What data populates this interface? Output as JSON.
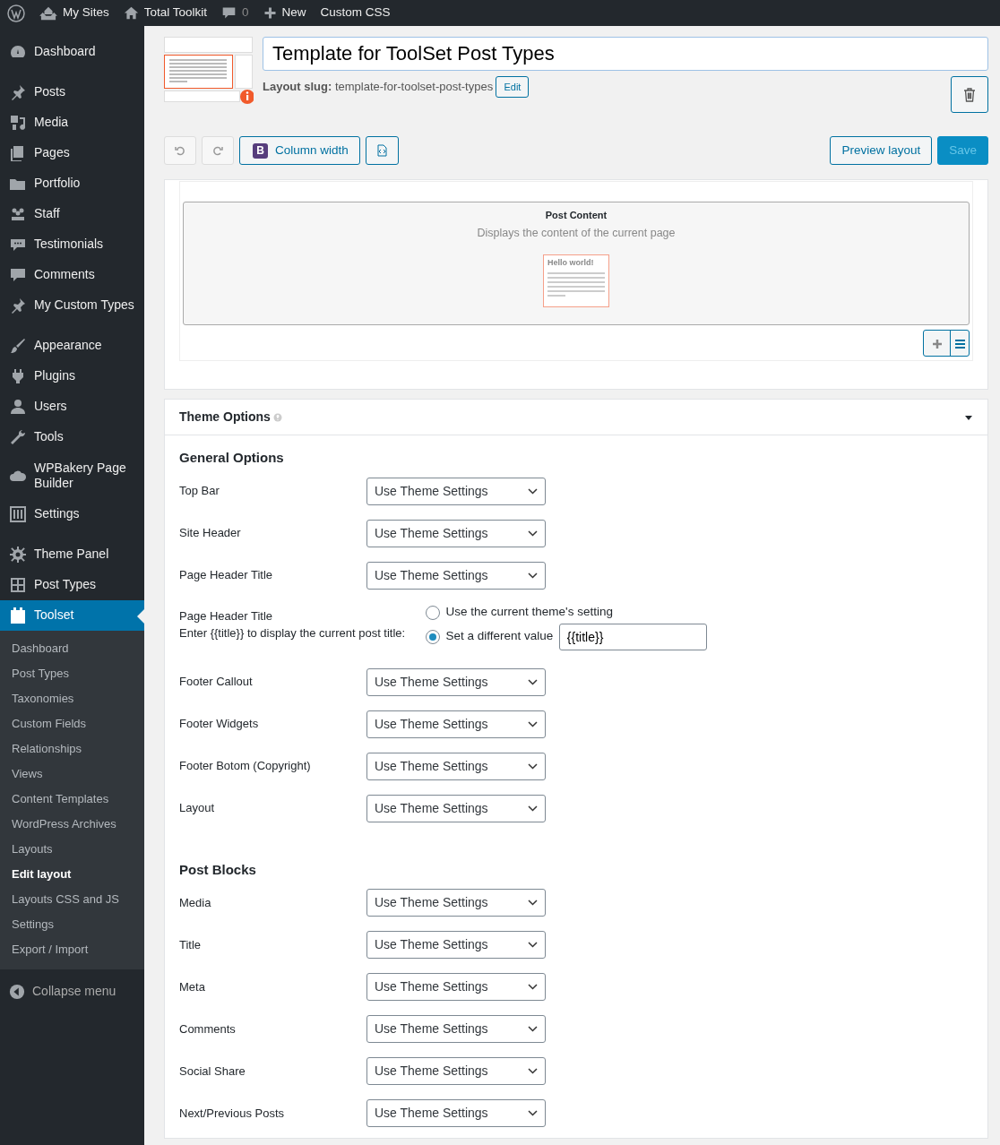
{
  "admin_bar": {
    "items": [
      {
        "kind": "logo"
      },
      {
        "kind": "sites",
        "label": "My Sites"
      },
      {
        "kind": "home",
        "label": "Total Toolkit"
      },
      {
        "kind": "comments",
        "label": "0"
      },
      {
        "kind": "new",
        "label": "New"
      },
      {
        "kind": "text",
        "label": "Custom CSS"
      }
    ]
  },
  "sidebar": {
    "groups": [
      [
        {
          "label": "Dashboard",
          "selected": false
        }
      ],
      [
        {
          "label": "Posts",
          "selected": false
        },
        {
          "label": "Media",
          "selected": false
        },
        {
          "label": "Pages",
          "selected": false
        },
        {
          "label": "Portfolio",
          "selected": false
        },
        {
          "label": "Staff",
          "selected": false
        },
        {
          "label": "Testimonials",
          "selected": false
        },
        {
          "label": "Comments",
          "selected": false
        },
        {
          "label": "My Custom Types",
          "selected": false
        }
      ],
      [
        {
          "label": "Appearance",
          "selected": false
        },
        {
          "label": "Plugins",
          "selected": false
        },
        {
          "label": "Users",
          "selected": false
        },
        {
          "label": "Tools",
          "selected": false
        },
        {
          "label": "WPBakery Page Builder",
          "selected": false
        },
        {
          "label": "Settings",
          "selected": false
        }
      ],
      [
        {
          "label": "Theme Panel",
          "selected": false
        },
        {
          "label": "Post Types",
          "selected": false
        },
        {
          "label": "Toolset",
          "selected": true
        }
      ]
    ],
    "submenu": [
      {
        "label": "Dashboard",
        "selected": false
      },
      {
        "label": "Post Types",
        "selected": false
      },
      {
        "label": "Taxonomies",
        "selected": false
      },
      {
        "label": "Custom Fields",
        "selected": false
      },
      {
        "label": "Relationships",
        "selected": false
      },
      {
        "label": "Views",
        "selected": false
      },
      {
        "label": "Content Templates",
        "selected": false
      },
      {
        "label": "WordPress Archives",
        "selected": false
      },
      {
        "label": "Layouts",
        "selected": false
      },
      {
        "label": "Edit layout",
        "selected": true
      },
      {
        "label": "Layouts CSS and JS",
        "selected": false
      },
      {
        "label": "Settings",
        "selected": false
      },
      {
        "label": "Export / Import",
        "selected": false
      }
    ],
    "collapse": "Collapse menu"
  },
  "header": {
    "title": "Template for ToolSet Post Types",
    "slug_label": "Layout slug:",
    "slug": "template-for-toolset-post-types",
    "edit": "Edit"
  },
  "toolbar": {
    "column_width": "Column width",
    "badge": "B",
    "preview": "Preview layout",
    "save": "Save",
    "save_disabled": true
  },
  "canvas": {
    "cell_title": "Post Content",
    "cell_desc": "Displays the content of the current page",
    "preview_heading": "Hello world!"
  },
  "theme_options": {
    "title": "Theme Options",
    "expanded": true,
    "sections": [
      {
        "heading": "General Options",
        "fields": [
          {
            "kind": "select",
            "label": "Top Bar",
            "value": "Use Theme Settings"
          },
          {
            "kind": "select",
            "label": "Site Header",
            "value": "Use Theme Settings"
          },
          {
            "kind": "select",
            "label": "Page Header Title",
            "value": "Use Theme Settings"
          },
          {
            "kind": "radio",
            "label": "Page Header Title",
            "hint": "Enter {{title}} to display the current post title:",
            "options": [
              {
                "label": "Use the current theme's setting",
                "selected": false
              },
              {
                "label": "Set a different value",
                "selected": true
              }
            ],
            "value": "{{title}}"
          },
          {
            "kind": "select",
            "label": "Footer Callout",
            "value": "Use Theme Settings"
          },
          {
            "kind": "select",
            "label": "Footer Widgets",
            "value": "Use Theme Settings"
          },
          {
            "kind": "select",
            "label": "Footer Botom (Copyright)",
            "value": "Use Theme Settings"
          },
          {
            "kind": "select",
            "label": "Layout",
            "value": "Use Theme Settings"
          }
        ]
      },
      {
        "heading": "Post Blocks",
        "fields": [
          {
            "kind": "select",
            "label": "Media",
            "value": "Use Theme Settings"
          },
          {
            "kind": "select",
            "label": "Title",
            "value": "Use Theme Settings"
          },
          {
            "kind": "select",
            "label": "Meta",
            "value": "Use Theme Settings"
          },
          {
            "kind": "select",
            "label": "Comments",
            "value": "Use Theme Settings"
          },
          {
            "kind": "select",
            "label": "Social Share",
            "value": "Use Theme Settings"
          },
          {
            "kind": "select",
            "label": "Next/Previous Posts",
            "value": "Use Theme Settings"
          }
        ]
      }
    ]
  }
}
